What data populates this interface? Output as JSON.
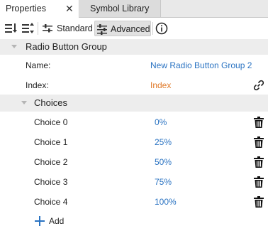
{
  "tabs": [
    {
      "label": "Properties",
      "active": true
    },
    {
      "label": "Symbol Library",
      "active": false
    }
  ],
  "toolbar": {
    "sort_icon_1": "sort-descending-icon",
    "sort_icon_2": "sort-categorized-icon",
    "standard_label": "Standard",
    "advanced_label": "Advanced",
    "info_icon": "info-icon"
  },
  "group": {
    "title": "Radio Button Group",
    "name_label": "Name:",
    "name_value": "New Radio Button Group 2",
    "index_label": "Index:",
    "index_value": "Index"
  },
  "choices": {
    "title": "Choices",
    "items": [
      {
        "label": "Choice 0",
        "value": "0%"
      },
      {
        "label": "Choice 1",
        "value": "25%"
      },
      {
        "label": "Choice 2",
        "value": "50%"
      },
      {
        "label": "Choice 3",
        "value": "75%"
      },
      {
        "label": "Choice 4",
        "value": "100%"
      }
    ],
    "add_label": "Add"
  },
  "colors": {
    "link_blue": "#2a73c2",
    "index_orange": "#e07b2c",
    "header_gray": "#ededed"
  }
}
